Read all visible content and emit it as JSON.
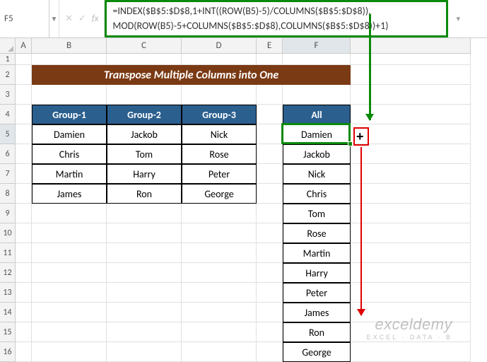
{
  "namebox": "F5",
  "formula": {
    "line1": "=INDEX($B$5:$D$8,1+INT((ROW(B5)-5)/COLUMNS($B$5:$D$8)),",
    "line2": "MOD(ROW(B5)-5+COLUMNS($B$5:$D$8),COLUMNS($B$5:$D$8))+1)"
  },
  "cols": [
    "A",
    "B",
    "C",
    "D",
    "E",
    "F"
  ],
  "rows": [
    "1",
    "2",
    "3",
    "4",
    "5",
    "6",
    "7",
    "8",
    "9",
    "10",
    "11",
    "12",
    "13",
    "14",
    "15",
    "16"
  ],
  "title": "Transpose Multiple Columns into One",
  "headers": {
    "b": "Group-1",
    "c": "Group-2",
    "d": "Group-3",
    "f": "All"
  },
  "data": {
    "r5": {
      "b": "Damien",
      "c": "Jackob",
      "d": "Nick",
      "f": "Damien"
    },
    "r6": {
      "b": "Chris",
      "c": "Tom",
      "d": "Rose",
      "f": "Jackob"
    },
    "r7": {
      "b": "Martin",
      "c": "Harry",
      "d": "Peter",
      "f": "Nick"
    },
    "r8": {
      "b": "James",
      "c": "Ron",
      "d": "George",
      "f": "Chris"
    },
    "r9": {
      "f": "Tom"
    },
    "r10": {
      "f": "Rose"
    },
    "r11": {
      "f": "Martin"
    },
    "r12": {
      "f": "Harry"
    },
    "r13": {
      "f": "Peter"
    },
    "r14": {
      "f": "James"
    },
    "r15": {
      "f": "Ron"
    },
    "r16": {
      "f": "George"
    }
  },
  "watermark": {
    "main": "exceldemy",
    "sub": "EXCEL · DATA · B"
  },
  "chart_data": {
    "type": "table",
    "title": "Transpose Multiple Columns into One",
    "columns": [
      "Group-1",
      "Group-2",
      "Group-3"
    ],
    "rows": [
      [
        "Damien",
        "Jackob",
        "Nick"
      ],
      [
        "Chris",
        "Tom",
        "Rose"
      ],
      [
        "Martin",
        "Harry",
        "Peter"
      ],
      [
        "James",
        "Ron",
        "George"
      ]
    ],
    "result_column": "All",
    "result_values": [
      "Damien",
      "Jackob",
      "Nick",
      "Chris",
      "Tom",
      "Rose",
      "Martin",
      "Harry",
      "Peter",
      "James",
      "Ron",
      "George"
    ],
    "formula": "=INDEX($B$5:$D$8,1+INT((ROW(B5)-5)/COLUMNS($B$5:$D$8)),MOD(ROW(B5)-5+COLUMNS($B$5:$D$8),COLUMNS($B$5:$D$8))+1)",
    "active_cell": "F5"
  }
}
